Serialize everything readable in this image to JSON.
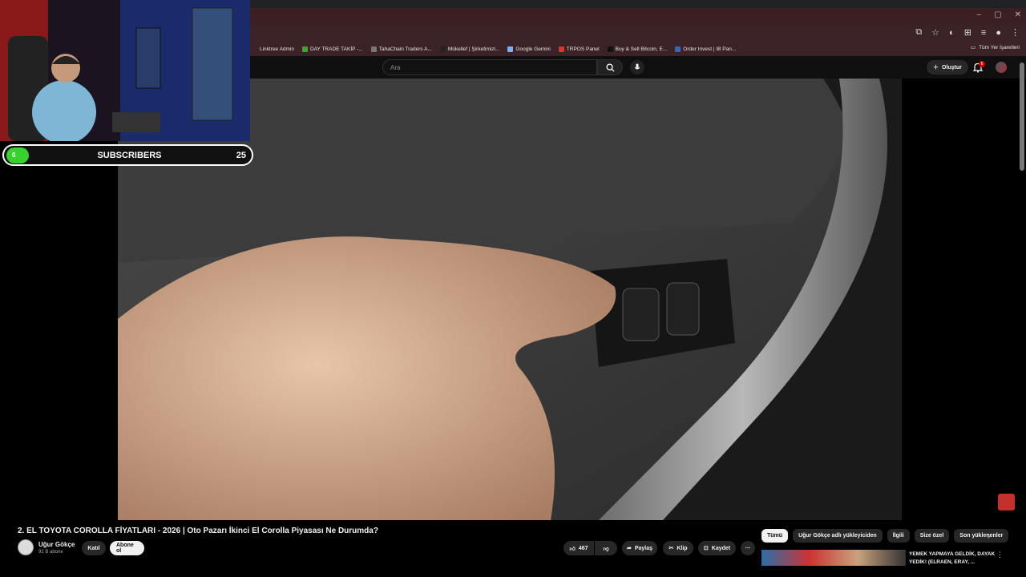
{
  "browser": {
    "bookmarks": [
      "Linktree Admin",
      "DAY TRADE TAKİP -...",
      "TahaChain Traders A...",
      "Mükellef | Şirketimizi...",
      "Google Gemini",
      "TRPOS Panel",
      "Buy & Sell Bitcoin, E...",
      "Order Invest | IB Pan..."
    ],
    "all_bookmarks": "Tüm Yer İşaretleri"
  },
  "youtube": {
    "search_placeholder": "Ara",
    "create_label": "Oluştur",
    "notification_count": "6",
    "video_title": "2. EL TOYOTA COROLLA FİYATLARI - 2026 | Oto Pazarı İkinci El Corolla Piyasası Ne Durumda?",
    "channel_name": "Uğur Gökçe",
    "channel_subs": "92 B abone",
    "join_label": "Katıl",
    "subscribe_label": "Abone ol",
    "like_count": "467",
    "share_label": "Paylaş",
    "clip_label": "Klip",
    "save_label": "Kaydet",
    "chips": [
      "Tümü",
      "Uğur Gökçe adlı yükleyiciden",
      "İlgili",
      "Size özel",
      "Son yüklenenler"
    ],
    "recommended": {
      "title": "YEMEK YAPMAYA GELDİK, DAYAK YEDİK! (ELRAEN, ERAY, ..."
    }
  },
  "overlay": {
    "sub_start": "0",
    "sub_label": "SUBSCRIBERS",
    "sub_goal": "25"
  }
}
